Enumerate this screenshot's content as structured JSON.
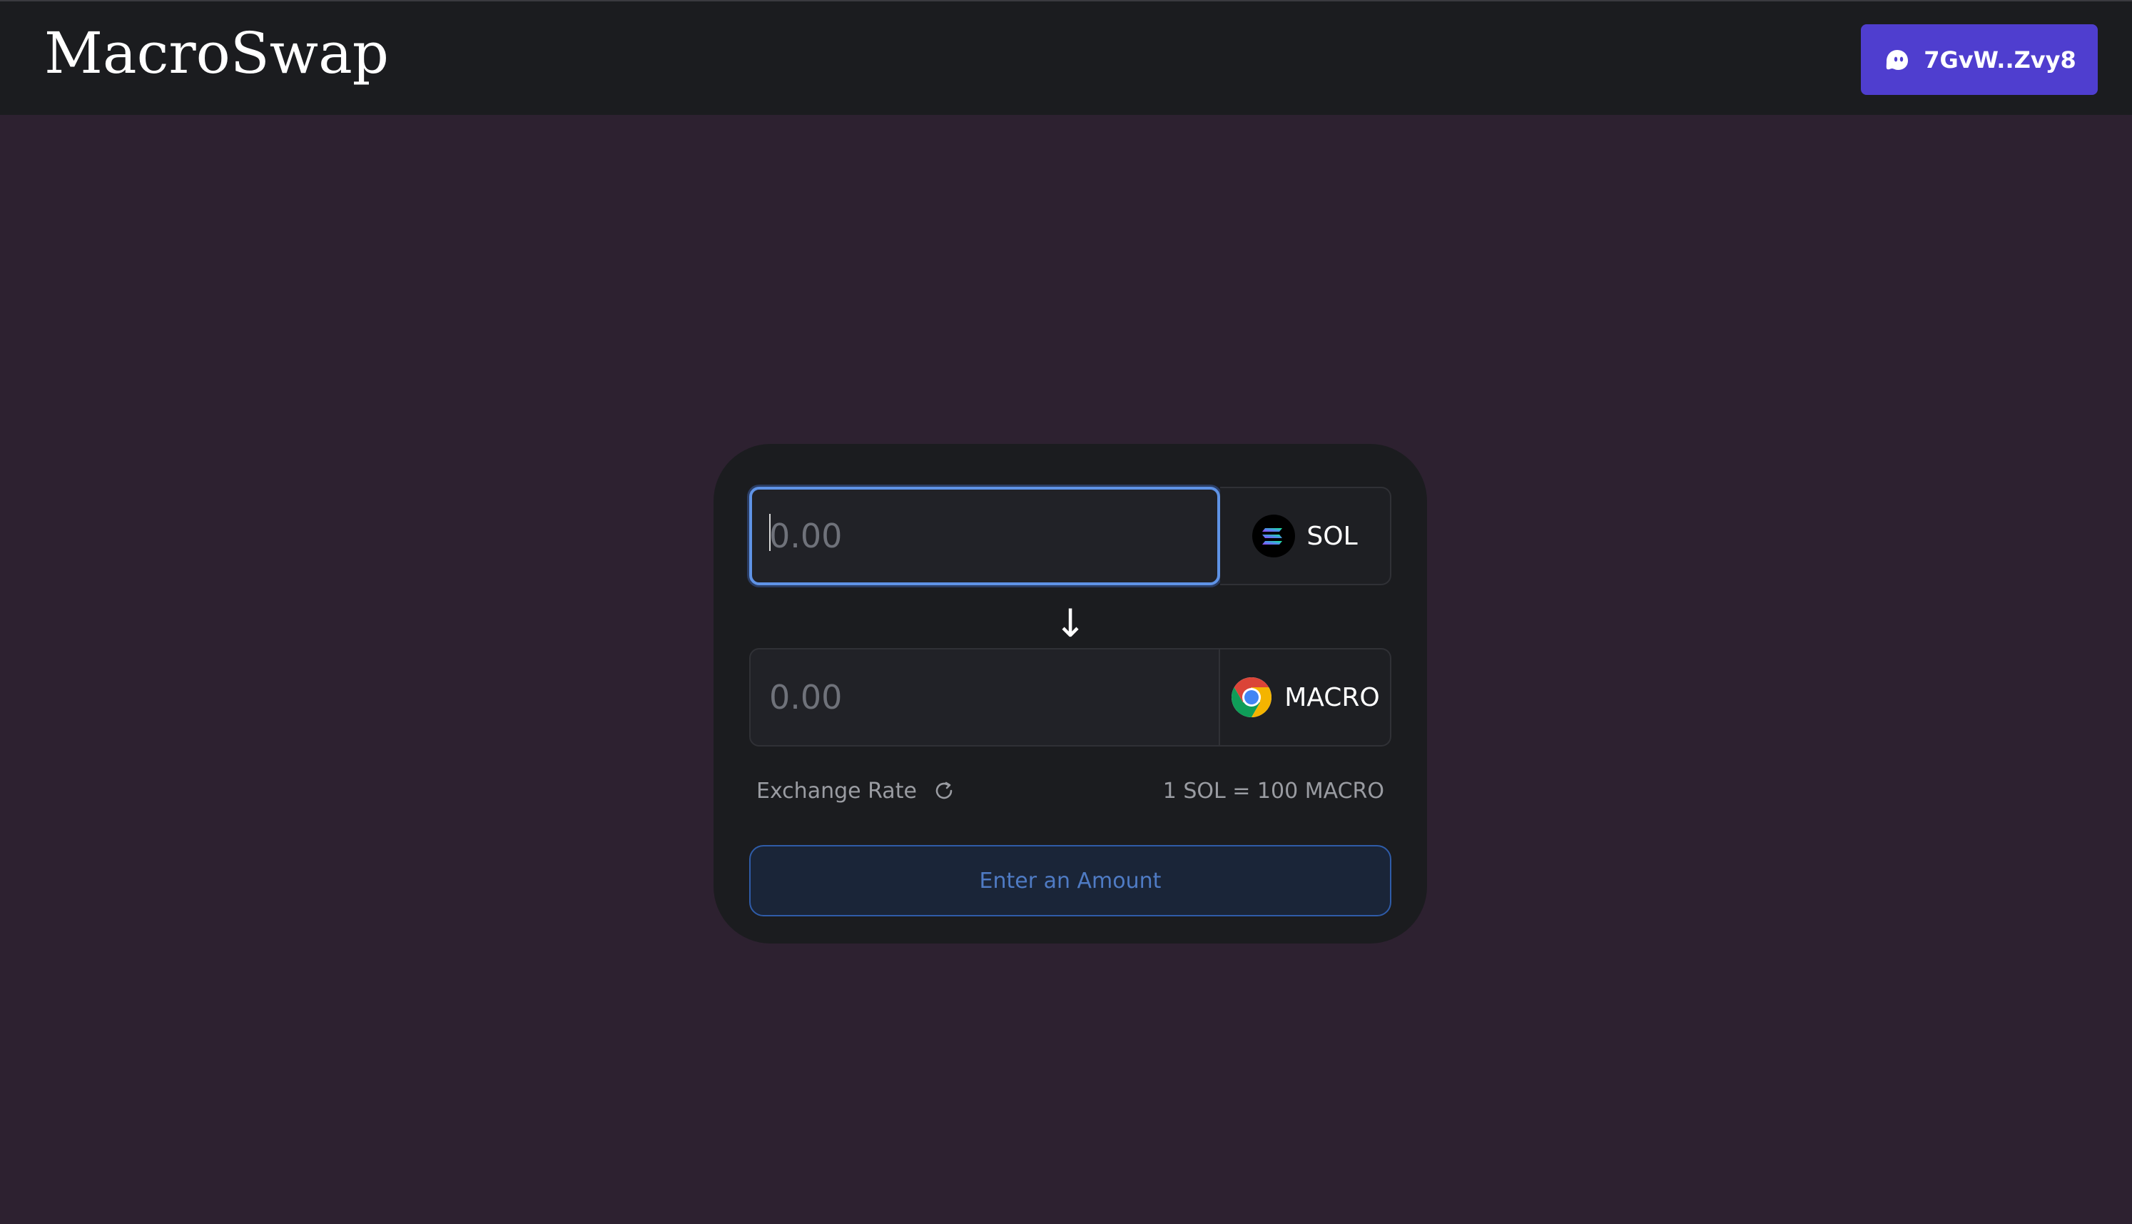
{
  "header": {
    "app_title": "MacroSwap",
    "wallet_label": "7GvW..Zvy8",
    "wallet_icon": "phantom-ghost-icon",
    "wallet_color": "#4f3ecf"
  },
  "swap": {
    "from": {
      "placeholder": "0.00",
      "token_symbol": "SOL",
      "token_icon": "solana-logo-icon"
    },
    "direction_icon": "arrow-down-icon",
    "to": {
      "placeholder": "0.00",
      "token_symbol": "MACRO",
      "token_icon": "chrome-logo-icon"
    },
    "exchange_rate_label": "Exchange Rate",
    "refresh_icon": "refresh-icon",
    "exchange_rate_value": "1 SOL = 100 MACRO",
    "submit_label": "Enter an Amount"
  },
  "colors": {
    "background": "#2d2130",
    "topbar": "#1b1c1f",
    "card": "#1b1c1f",
    "focus_border": "#5f93e6",
    "button_border": "#2f5ca8"
  }
}
